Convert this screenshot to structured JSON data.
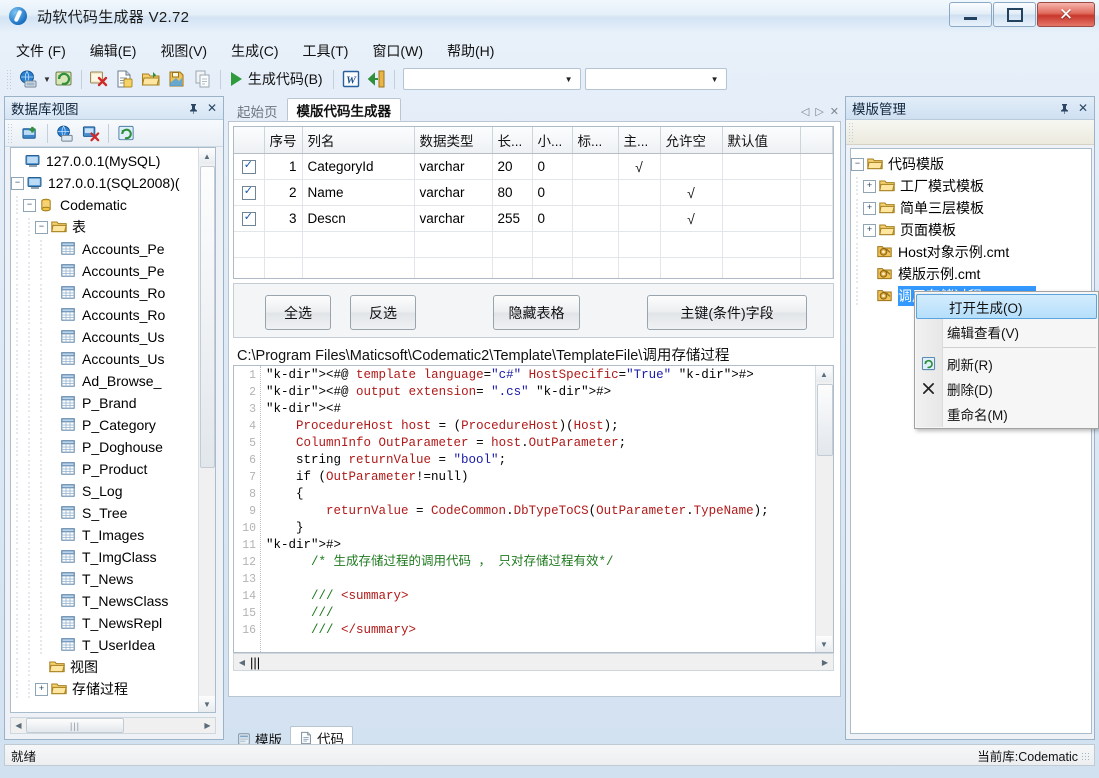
{
  "window": {
    "title": "动软代码生成器  V2.72",
    "icon": "app-logo-icon",
    "minimize": "—",
    "maximize": "▢",
    "close": "✕"
  },
  "menubar": {
    "items": [
      {
        "label": "文件 (F)"
      },
      {
        "label": "编辑(E)"
      },
      {
        "label": "视图(V)"
      },
      {
        "label": "生成(C)"
      },
      {
        "label": "工具(T)"
      },
      {
        "label": "窗口(W)"
      },
      {
        "label": "帮助(H)"
      }
    ]
  },
  "toolbar": {
    "generate_label": "生成代码(B)",
    "combo1_value": "",
    "combo2_value": "",
    "icons": [
      "connect-database-icon",
      "refresh-database-icon",
      "remove-database-icon",
      "new-document-icon",
      "open-folder-icon",
      "save-template-icon",
      "copy-icon"
    ],
    "after_icons": [
      "word-export-icon",
      "exit-icon"
    ]
  },
  "db_panel": {
    "title": "数据库视图",
    "pin": "📌",
    "close": "✕",
    "toolbar_icons": [
      "add-database-icon",
      "connect-icon",
      "disconnect-icon",
      "refresh-icon"
    ],
    "tree": [
      {
        "label": "127.0.0.1(MySQL)",
        "depth": 0,
        "expander": "",
        "icon": "server-icon"
      },
      {
        "label": "127.0.0.1(SQL2008)(",
        "depth": 0,
        "expander": "−",
        "icon": "server-icon"
      },
      {
        "label": "Codematic",
        "depth": 1,
        "expander": "−",
        "icon": "database-icon"
      },
      {
        "label": "表",
        "depth": 2,
        "expander": "−",
        "icon": "folder-icon"
      },
      {
        "label": "Accounts_Pe",
        "depth": 3,
        "expander": "",
        "icon": "table-icon"
      },
      {
        "label": "Accounts_Pe",
        "depth": 3,
        "expander": "",
        "icon": "table-icon"
      },
      {
        "label": "Accounts_Ro",
        "depth": 3,
        "expander": "",
        "icon": "table-icon"
      },
      {
        "label": "Accounts_Ro",
        "depth": 3,
        "expander": "",
        "icon": "table-icon"
      },
      {
        "label": "Accounts_Us",
        "depth": 3,
        "expander": "",
        "icon": "table-icon"
      },
      {
        "label": "Accounts_Us",
        "depth": 3,
        "expander": "",
        "icon": "table-icon"
      },
      {
        "label": "Ad_Browse_",
        "depth": 3,
        "expander": "",
        "icon": "table-icon"
      },
      {
        "label": "P_Brand",
        "depth": 3,
        "expander": "",
        "icon": "table-icon"
      },
      {
        "label": "P_Category",
        "depth": 3,
        "expander": "",
        "icon": "table-icon"
      },
      {
        "label": "P_Doghouse",
        "depth": 3,
        "expander": "",
        "icon": "table-icon"
      },
      {
        "label": "P_Product",
        "depth": 3,
        "expander": "",
        "icon": "table-icon"
      },
      {
        "label": "S_Log",
        "depth": 3,
        "expander": "",
        "icon": "table-icon"
      },
      {
        "label": "S_Tree",
        "depth": 3,
        "expander": "",
        "icon": "table-icon"
      },
      {
        "label": "T_Images",
        "depth": 3,
        "expander": "",
        "icon": "table-icon"
      },
      {
        "label": "T_ImgClass",
        "depth": 3,
        "expander": "",
        "icon": "table-icon"
      },
      {
        "label": "T_News",
        "depth": 3,
        "expander": "",
        "icon": "table-icon"
      },
      {
        "label": "T_NewsClass",
        "depth": 3,
        "expander": "",
        "icon": "table-icon"
      },
      {
        "label": "T_NewsRepl",
        "depth": 3,
        "expander": "",
        "icon": "table-icon"
      },
      {
        "label": "T_UserIdea",
        "depth": 3,
        "expander": "",
        "icon": "table-icon"
      },
      {
        "label": "视图",
        "depth": 2,
        "expander": "",
        "icon": "folder-icon"
      },
      {
        "label": "存储过程",
        "depth": 2,
        "expander": "+",
        "icon": "folder-icon"
      }
    ]
  },
  "center": {
    "doc_tabs": [
      {
        "label": "起始页",
        "active": false
      },
      {
        "label": "模版代码生成器",
        "active": true
      }
    ],
    "tab_nav": {
      "prev": "◁",
      "next": "▷",
      "close": "✕"
    },
    "grid": {
      "headers": [
        "",
        "序号",
        "列名",
        "数据类型",
        "长...",
        "小...",
        "标...",
        "主...",
        "允许空",
        "默认值",
        ""
      ],
      "rows": [
        {
          "checked": true,
          "no": "1",
          "name": "CategoryId",
          "type": "varchar",
          "len": "20",
          "dec": "0",
          "identity": "",
          "pk": "√",
          "nullable": "",
          "default": ""
        },
        {
          "checked": true,
          "no": "2",
          "name": "Name",
          "type": "varchar",
          "len": "80",
          "dec": "0",
          "identity": "",
          "pk": "",
          "nullable": "√",
          "default": ""
        },
        {
          "checked": true,
          "no": "3",
          "name": "Descn",
          "type": "varchar",
          "len": "255",
          "dec": "0",
          "identity": "",
          "pk": "",
          "nullable": "√",
          "default": ""
        }
      ]
    },
    "buttons": [
      {
        "label": "全选"
      },
      {
        "label": "反选"
      },
      {
        "label": "隐藏表格"
      },
      {
        "label": "主键(条件)字段"
      }
    ],
    "path": "C:\\Program Files\\Maticsoft\\Codematic2\\Template\\TemplateFile\\调用存储过程",
    "code_lines": [
      {
        "n": "1",
        "text": "<#@ template language=\"c#\" HostSpecific=\"True\" #>"
      },
      {
        "n": "2",
        "text": "<#@ output extension= \".cs\" #>"
      },
      {
        "n": "3",
        "text": "<#"
      },
      {
        "n": "4",
        "text": "    ProcedureHost host = (ProcedureHost)(Host);"
      },
      {
        "n": "5",
        "text": "    ColumnInfo OutParameter = host.OutParameter;"
      },
      {
        "n": "6",
        "text": "    string returnValue = \"bool\";"
      },
      {
        "n": "7",
        "text": "    if (OutParameter!=null)"
      },
      {
        "n": "8",
        "text": "    {"
      },
      {
        "n": "9",
        "text": "        returnValue = CodeCommon.DbTypeToCS(OutParameter.TypeName);"
      },
      {
        "n": "10",
        "text": "    }"
      },
      {
        "n": "11",
        "text": "#>"
      },
      {
        "n": "12",
        "text": "      /* 生成存储过程的调用代码 ， 只对存储过程有效*/"
      },
      {
        "n": "13",
        "text": ""
      },
      {
        "n": "14",
        "text": "      /// <summary>"
      },
      {
        "n": "15",
        "text": "      ///"
      },
      {
        "n": "16",
        "text": "      /// </summary>"
      }
    ],
    "bottom_tabs": [
      {
        "label": "模版",
        "icon": "template-icon",
        "active": false
      },
      {
        "label": "代码",
        "icon": "code-icon",
        "active": true
      }
    ]
  },
  "tpl_panel": {
    "title": "模版管理",
    "pin": "📌",
    "close": "✕",
    "tree": [
      {
        "label": "代码模版",
        "depth": 0,
        "expander": "−",
        "icon": "folder-icon",
        "selected": false
      },
      {
        "label": "工厂模式模板",
        "depth": 1,
        "expander": "+",
        "icon": "folder-icon",
        "selected": false
      },
      {
        "label": "简单三层模板",
        "depth": 1,
        "expander": "+",
        "icon": "folder-icon",
        "selected": false
      },
      {
        "label": "页面模板",
        "depth": 1,
        "expander": "+",
        "icon": "folder-icon",
        "selected": false
      },
      {
        "label": "Host对象示例.cmt",
        "depth": 1,
        "expander": "",
        "icon": "template-file-icon",
        "selected": false
      },
      {
        "label": "模版示例.cmt",
        "depth": 1,
        "expander": "",
        "icon": "template-file-icon",
        "selected": false
      },
      {
        "label": "调用存储过程DAL.cmt",
        "depth": 1,
        "expander": "",
        "icon": "template-file-icon",
        "selected": true
      }
    ]
  },
  "context_menu": {
    "items": [
      {
        "label": "打开生成(O)",
        "icon": "",
        "highlighted": true
      },
      {
        "label": "编辑查看(V)",
        "icon": "",
        "highlighted": false
      },
      {
        "label": "刷新(R)",
        "icon": "refresh-icon",
        "highlighted": false
      },
      {
        "label": "删除(D)",
        "icon": "delete-x-icon",
        "highlighted": false
      },
      {
        "label": "重命名(M)",
        "icon": "",
        "highlighted": false
      }
    ]
  },
  "statusbar": {
    "left": "就绪",
    "right": "当前库:Codematic"
  },
  "colors": {
    "accent": "#3399ff",
    "title_blue": "#10253c",
    "menu_highlight": "#5aa5de"
  }
}
